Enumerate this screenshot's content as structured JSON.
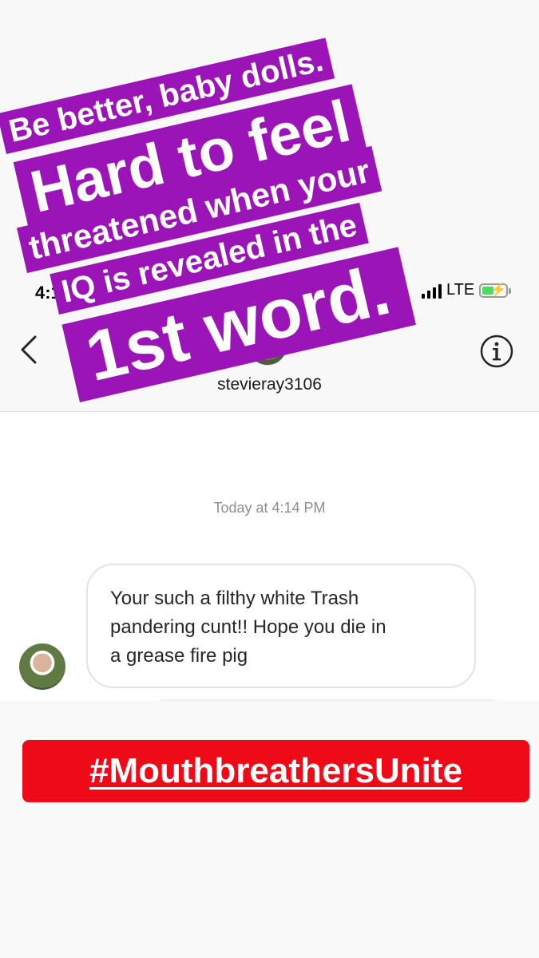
{
  "status_bar": {
    "time": "4:1",
    "network": "LTE",
    "battery_color": "#4cd964"
  },
  "header": {
    "back_icon": "chevron-left-icon",
    "info_icon": "info-circle-icon",
    "username": "stevieray3106"
  },
  "conversation": {
    "timestamp": "Today at 4:14 PM",
    "messages": [
      {
        "line_1": "Your such a filthy white Trash",
        "line_2": "pandering cunt!! Hope you die in",
        "line_3": "a grease fire pig"
      }
    ]
  },
  "overlay": {
    "purple_color": "#9b14b8",
    "line_1": "Be better, baby dolls.",
    "line_2": "Hard to feel",
    "line_3": "threatened when your",
    "line_4": "IQ is revealed in the",
    "line_5": "1st word.",
    "hashtag": "#MouthbreathersUnite",
    "hashtag_color": "#ee0a16"
  }
}
